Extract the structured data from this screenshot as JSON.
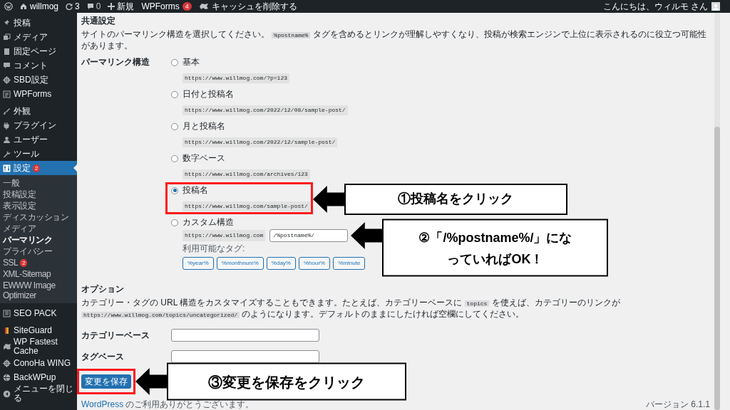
{
  "admin_bar": {
    "site": "willmog",
    "updates": "3",
    "comments": "0",
    "new": "新規",
    "wpforms": {
      "label": "WPForms",
      "badge": "4"
    },
    "cache": "キャッシュを削除する",
    "greeting": "こんにちは、ウィルモ さん"
  },
  "sidebar": {
    "groups": [
      [
        {
          "label": "投稿",
          "selected": false
        },
        {
          "label": "メディア",
          "selected": false
        },
        {
          "label": "固定ページ",
          "selected": false
        },
        {
          "label": "コメント",
          "selected": false
        },
        {
          "label": "SBD設定",
          "selected": false
        },
        {
          "label": "WPForms",
          "selected": false
        }
      ],
      [
        {
          "label": "外観",
          "selected": false
        },
        {
          "label": "プラグイン",
          "selected": false
        },
        {
          "label": "ユーザー",
          "selected": false
        },
        {
          "label": "ツール",
          "selected": false
        },
        {
          "label": "設定",
          "selected": true,
          "badge": "2",
          "children": [
            {
              "label": "一般",
              "selected": false
            },
            {
              "label": "投稿設定",
              "selected": false
            },
            {
              "label": "表示設定",
              "selected": false
            },
            {
              "label": "ディスカッション",
              "selected": false
            },
            {
              "label": "メディア",
              "selected": false
            },
            {
              "label": "パーマリンク",
              "selected": true
            },
            {
              "label": "プライバシー",
              "selected": false
            },
            {
              "label": "SSL",
              "selected": false,
              "badge": "2"
            },
            {
              "label": "XML-Sitemap",
              "selected": false
            },
            {
              "label": "EWWW Image Optimizer",
              "selected": false
            }
          ]
        }
      ],
      [
        {
          "label": "SEO PACK",
          "selected": false
        }
      ],
      [
        {
          "label": "SiteGuard",
          "selected": false
        },
        {
          "label": "WP Fastest Cache",
          "selected": false
        },
        {
          "label": "ConoHa WING",
          "selected": false
        },
        {
          "label": "BackWPup",
          "selected": false
        },
        {
          "label": "メニューを閉じる",
          "selected": false
        }
      ]
    ]
  },
  "common": {
    "heading": "共通設定",
    "description_before": "サイトのパーマリンク構造を選択してください。",
    "description_code": "%postname%",
    "description_after": "タグを含めるとリンクが理解しやすくなり、投稿が検索エンジンで上位に表示されるのに役立つ可能性があります。"
  },
  "permalink": {
    "label": "パーマリンク構造",
    "options": [
      {
        "kind": "preset",
        "label": "基本",
        "example": "https://www.willmog.com/?p=123",
        "selected": false
      },
      {
        "kind": "preset",
        "label": "日付と投稿名",
        "example": "https://www.willmog.com/2022/12/08/sample-post/",
        "selected": false
      },
      {
        "kind": "preset",
        "label": "月と投稿名",
        "example": "https://www.willmog.com/2022/12/sample-post/",
        "selected": false
      },
      {
        "kind": "preset",
        "label": "数字ベース",
        "example": "https://www.willmog.com/archives/123",
        "selected": false
      },
      {
        "kind": "preset",
        "label": "投稿名",
        "example": "https://www.willmog.com/sample-post/",
        "selected": true
      },
      {
        "kind": "custom",
        "label": "カスタム構造",
        "prefix": "https://www.willmog.com",
        "value": "/%postname%/",
        "tags_label": "利用可能なタグ:",
        "tags": [
          "%year%",
          "%monthnum%",
          "%day%",
          "%hour%",
          "%minute"
        ],
        "selected": false
      }
    ]
  },
  "optional": {
    "heading": "オプション",
    "description_1": "カテゴリー・タグの URL 構造をカスタマイズすることもできます。たとえば、カテゴリーベースに",
    "code_1": "topics",
    "description_2": "を使えば、カテゴリーのリンクが",
    "code_2": "https://www.willmog.com/topics/uncategorized/",
    "description_3": "のようになります。デフォルトのままにしたければ空欄にしてください。",
    "fields": [
      {
        "label": "カテゴリーベース"
      },
      {
        "label": "タグベース"
      }
    ]
  },
  "save_button": "変更を保存",
  "footer": {
    "link": "WordPress",
    "thanks": "のご利用ありがとうございます。",
    "version": "バージョン 6.1.1"
  },
  "annotations": [
    {
      "lines": [
        "①投稿名をクリック"
      ],
      "highlight": true
    },
    {
      "lines": [
        "②「/%postname%/」にな",
        "っていればOK！"
      ],
      "highlight": false
    },
    {
      "lines": [
        "③変更を保存をクリック"
      ],
      "highlight": true
    }
  ]
}
